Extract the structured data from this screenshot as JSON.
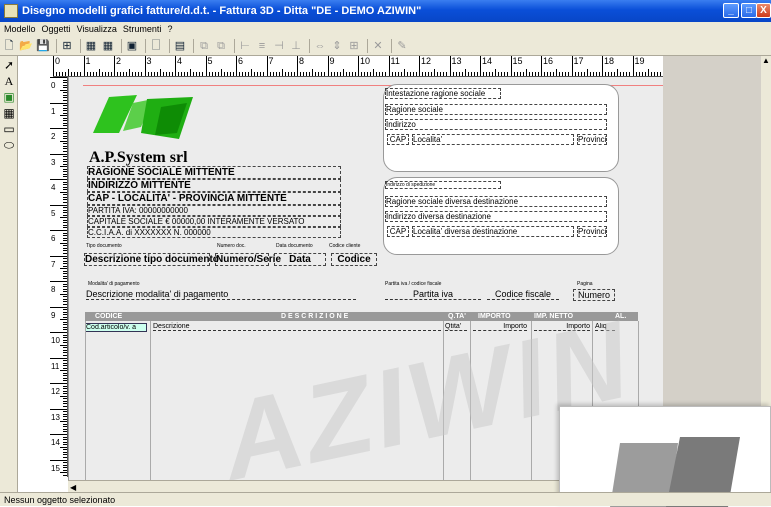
{
  "window": {
    "title": "Disegno modelli grafici fatture/d.d.t. - Fattura 3D - Ditta \"DE - DEMO AZIWIN\"",
    "buttons": [
      "_",
      "□",
      "X"
    ]
  },
  "menu": [
    "Modello",
    "Oggetti",
    "Visualizza",
    "Strumenti",
    "?"
  ],
  "toolbar": {
    "icons": [
      "new-icon",
      "open-icon",
      "save-icon",
      "grid-icon",
      "table-icon",
      "table2-icon",
      "image-icon",
      "page-icon",
      "lock-icon",
      "copy-icon",
      "paste-icon",
      "align-left-icon",
      "align-center-icon",
      "align-right-icon",
      "align-bottom-icon",
      "distribute-icon",
      "size-icon",
      "grid2-icon",
      "delete-icon",
      "props-icon"
    ]
  },
  "palette": [
    "pointer-tool",
    "text-tool",
    "image-tool",
    "table-tool",
    "rectangle-tool",
    "ellipse-tool"
  ],
  "ruler": {
    "h_labels": [
      "0",
      "1",
      "2",
      "3",
      "4",
      "5",
      "6",
      "7",
      "8",
      "9",
      "10",
      "11",
      "12",
      "13",
      "14",
      "15",
      "16",
      "17",
      "18",
      "19",
      "20"
    ],
    "v_labels": [
      "0",
      "1",
      "2",
      "3",
      "4",
      "5",
      "6",
      "7",
      "8",
      "9",
      "10",
      "11",
      "12",
      "13",
      "14",
      "15"
    ]
  },
  "company": {
    "name": "A.P.System srl",
    "lines": [
      "RAGIONE SOCIALE MITTENTE",
      "INDIRIZZO MITTENTE",
      "CAP - LOCALITA' - PROVINCIA MITTENTE",
      "PARTITA IVA: 00000000000",
      "CAPITALE SOCIALE € 00000,00 INTERAMENTE VERSATO",
      "C.C.I.A.A. di XXXXXXX N. 000000"
    ]
  },
  "recipient": {
    "header": "Intestazione ragione sociale",
    "ragione": "Ragione sociale",
    "indirizzo": "Indirizzo",
    "cap": "CAP",
    "localita": "Localita'",
    "provincia": "Provinci"
  },
  "destination": {
    "header": "Indirizzo di spedizione",
    "ragione": "Ragione sociale diversa destinazione",
    "indirizzo": "Indirizzo diversa destinazione",
    "cap": "CAP",
    "localita": "Localita' diversa destinazione",
    "provincia": "Provinci"
  },
  "document": {
    "lbl_tipo": "Tipo documento",
    "lbl_numero": "Numero doc.",
    "lbl_data": "Data documento",
    "lbl_codice": "Codice cliente",
    "tipo": "Descrizione tipo documento",
    "numero": "Numero/Serie",
    "data": "Data",
    "codice": "Codice"
  },
  "payment": {
    "lbl_modalita": "Modalita' di pagamento",
    "modalita": "Descrizione modalita' di pagamento",
    "lbl_piva": "Partita iva / codice fiscale",
    "piva": "Partita iva",
    "cf": "Codice fiscale",
    "lbl_pagina": "Pagina",
    "pagina": "Numero"
  },
  "table": {
    "headers": [
      "CODICE",
      "D E S C R I Z I O N E",
      "Q.TA'",
      "IMPORTO",
      "IMP. NETTO",
      "AL."
    ],
    "row": [
      "Cod.articolo/v. a",
      "Descrizione",
      "Qtita'",
      "Importo",
      "Importo",
      "Aliq"
    ]
  },
  "watermark": "AZIWIN",
  "status": "Nessun oggetto selezionato"
}
